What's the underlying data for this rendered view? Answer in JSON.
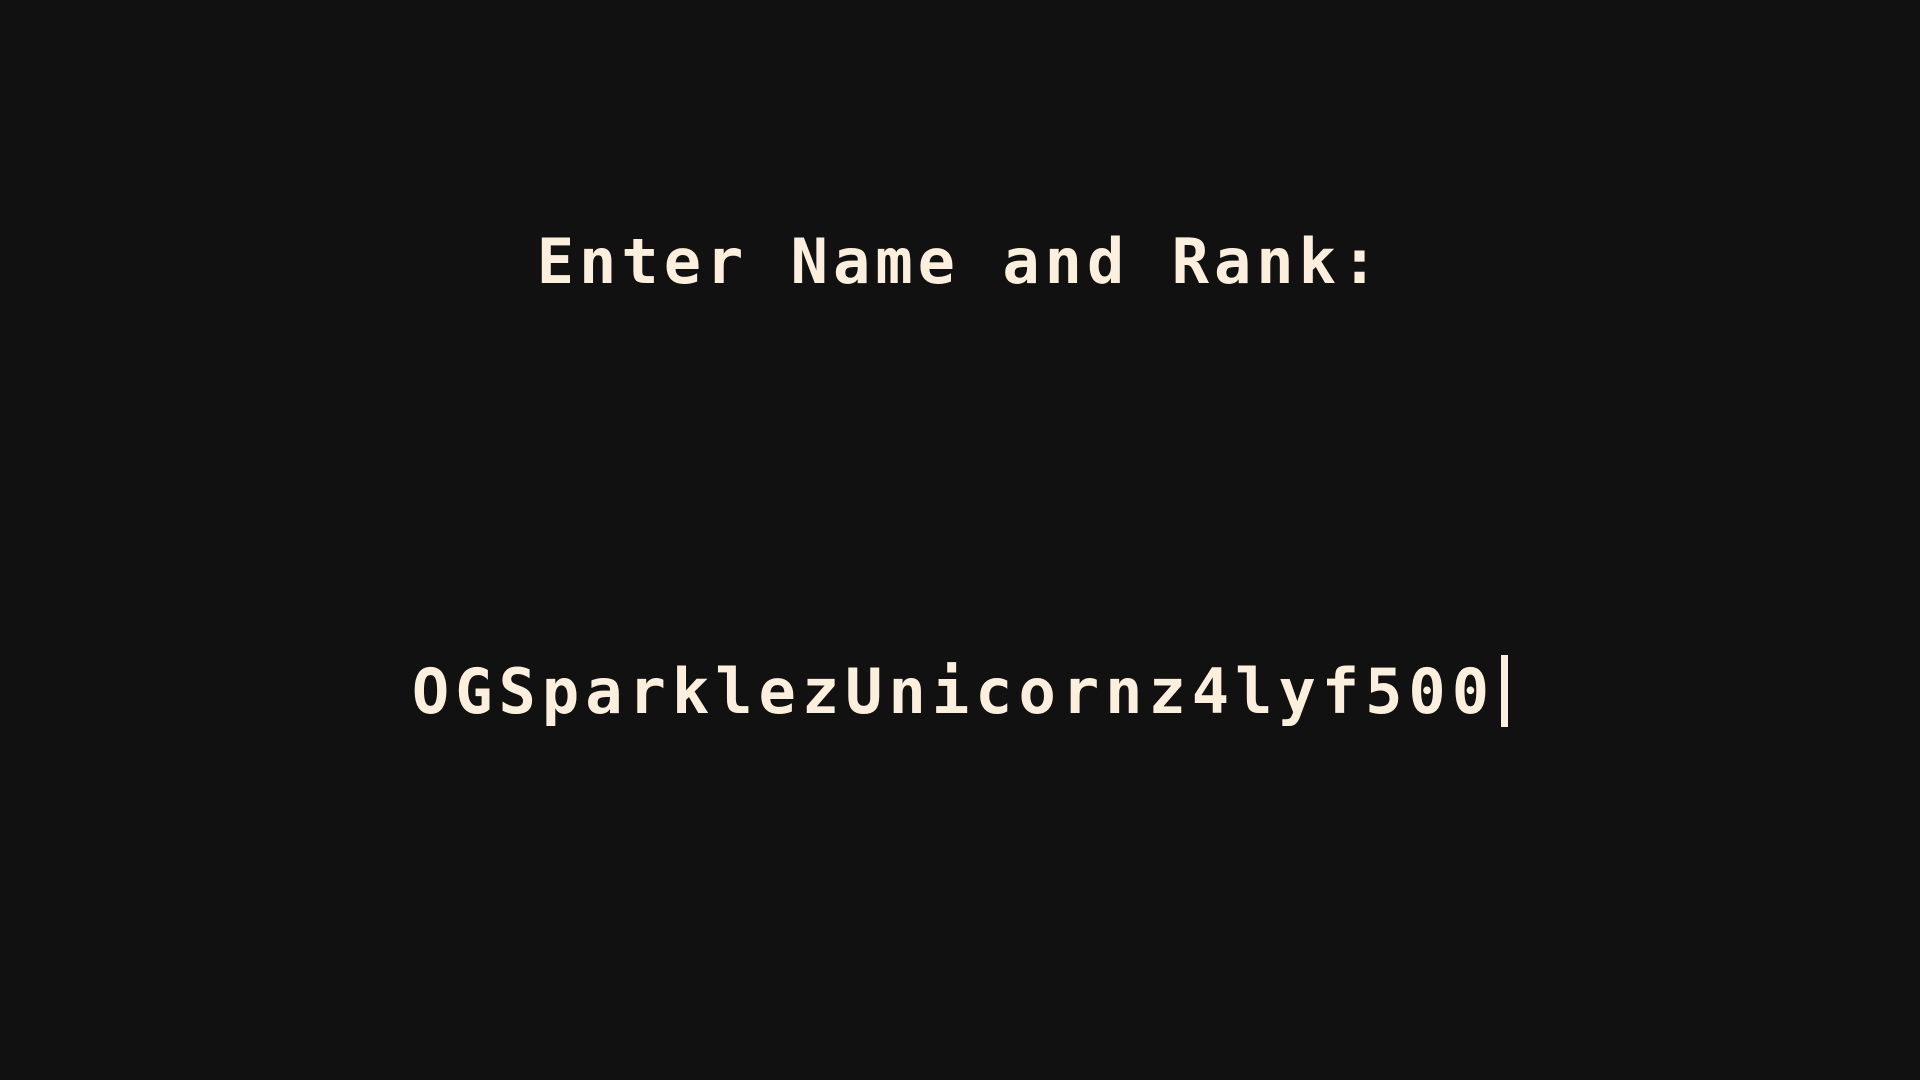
{
  "screen": {
    "prompt": "Enter Name and Rank:",
    "entry_value": "OGSparklezUnicornz4lyf500",
    "cursor_glyph": "|"
  },
  "colors": {
    "background": "#111111",
    "text": "#fcefdd"
  }
}
